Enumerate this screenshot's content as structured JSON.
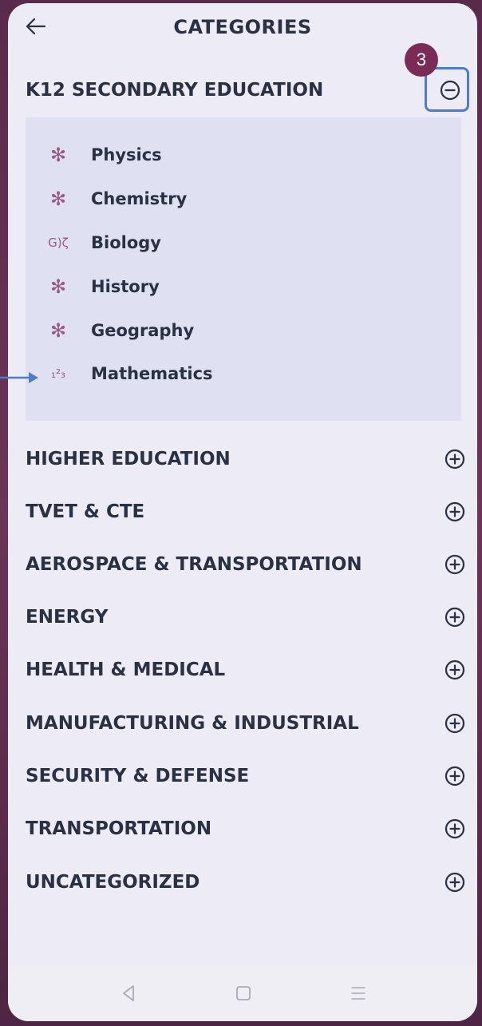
{
  "header": {
    "title": "CATEGORIES"
  },
  "callout": {
    "step_number": "3",
    "accent_color": "#4f7cc8",
    "badge_color": "#7a2c57"
  },
  "expanded_category": {
    "label": "K12 SECONDARY EDUCATION",
    "toggle_icon": "minus-circle-icon",
    "subcategories": [
      {
        "label": "Physics",
        "icon": "asterisk-icon",
        "glyph": "✻"
      },
      {
        "label": "Chemistry",
        "icon": "asterisk-icon",
        "glyph": "✻"
      },
      {
        "label": "Biology",
        "icon": "biology-icon",
        "glyph": "G)ζ"
      },
      {
        "label": "History",
        "icon": "asterisk-icon",
        "glyph": "✻"
      },
      {
        "label": "Geography",
        "icon": "asterisk-icon",
        "glyph": "✻"
      },
      {
        "label": "Mathematics",
        "icon": "numbers-icon",
        "glyph": "₁²₃"
      }
    ]
  },
  "categories": [
    {
      "label": "HIGHER EDUCATION",
      "toggle_icon": "plus-circle-icon"
    },
    {
      "label": "TVET & CTE",
      "toggle_icon": "plus-circle-icon"
    },
    {
      "label": "AEROSPACE & TRANSPORTATION",
      "toggle_icon": "plus-circle-icon"
    },
    {
      "label": "ENERGY",
      "toggle_icon": "plus-circle-icon"
    },
    {
      "label": "HEALTH & MEDICAL",
      "toggle_icon": "plus-circle-icon"
    },
    {
      "label": "MANUFACTURING & INDUSTRIAL",
      "toggle_icon": "plus-circle-icon"
    },
    {
      "label": "SECURITY & DEFENSE",
      "toggle_icon": "plus-circle-icon"
    },
    {
      "label": "TRANSPORTATION",
      "toggle_icon": "plus-circle-icon"
    },
    {
      "label": "UNCATEGORIZED",
      "toggle_icon": "plus-circle-icon"
    }
  ],
  "navbar": {
    "buttons": [
      "back-triangle-icon",
      "home-square-icon",
      "menu-lines-icon"
    ]
  }
}
